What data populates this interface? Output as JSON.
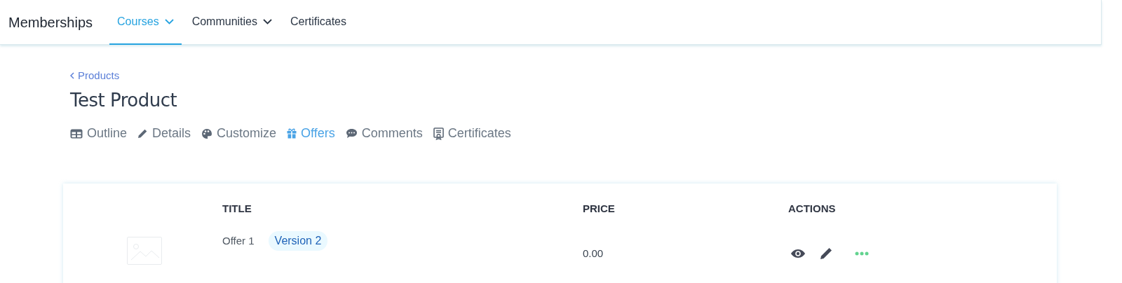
{
  "app_title": "Memberships",
  "nav": [
    {
      "label": "Courses",
      "dropdown": true,
      "selected": true
    },
    {
      "label": "Communities",
      "dropdown": true,
      "selected": false
    },
    {
      "label": "Certificates",
      "dropdown": false,
      "selected": false
    }
  ],
  "breadcrumb": "Products",
  "page_title": "Test Product",
  "tabs": [
    {
      "kind": "outline",
      "label": "Outline",
      "selected": false
    },
    {
      "kind": "details",
      "label": "Details",
      "selected": false
    },
    {
      "kind": "customize",
      "label": "Customize",
      "selected": false
    },
    {
      "kind": "offers",
      "label": "Offers",
      "selected": true
    },
    {
      "kind": "comments",
      "label": "Comments",
      "selected": false
    },
    {
      "kind": "certificates",
      "label": "Certificates",
      "selected": false
    }
  ],
  "table": {
    "columns": [
      "TITLE",
      "PRICE",
      "ACTIONS"
    ],
    "rows": [
      {
        "title": "Offer 1",
        "badge": "Version 2",
        "price": "0.00"
      }
    ]
  }
}
